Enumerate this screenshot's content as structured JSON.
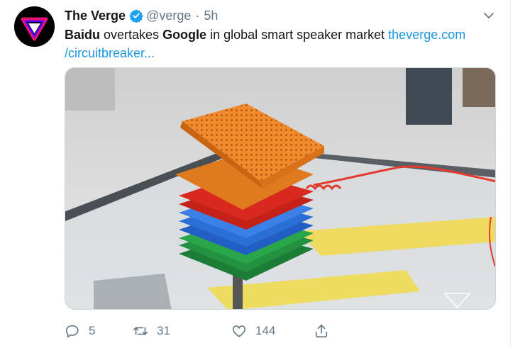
{
  "tweet": {
    "author_name": "The Verge",
    "handle": "@verge",
    "separator": "·",
    "time": "5h",
    "text_bold_1": "Baidu",
    "text_1": " overtakes ",
    "text_bold_2": "Google",
    "text_2": " in global smart speaker market ",
    "link_1": "theverge.com",
    "link_2": "/circuitbreaker...",
    "actions": {
      "reply_count": "5",
      "retweet_count": "31",
      "like_count": "144"
    }
  },
  "icons": {
    "avatar": "verge-logo-icon",
    "verified": "verified-badge-icon",
    "caret": "chevron-down-icon",
    "reply": "reply-icon",
    "retweet": "retweet-icon",
    "like": "heart-icon",
    "share": "share-icon"
  },
  "colors": {
    "link": "#1b95e0",
    "verified": "#1da1f2",
    "muted": "#657786",
    "speaker_orange": "#f08a2c",
    "speaker_red": "#d9281d",
    "speaker_blue": "#2a6fd6",
    "speaker_green": "#1f8a3a"
  }
}
